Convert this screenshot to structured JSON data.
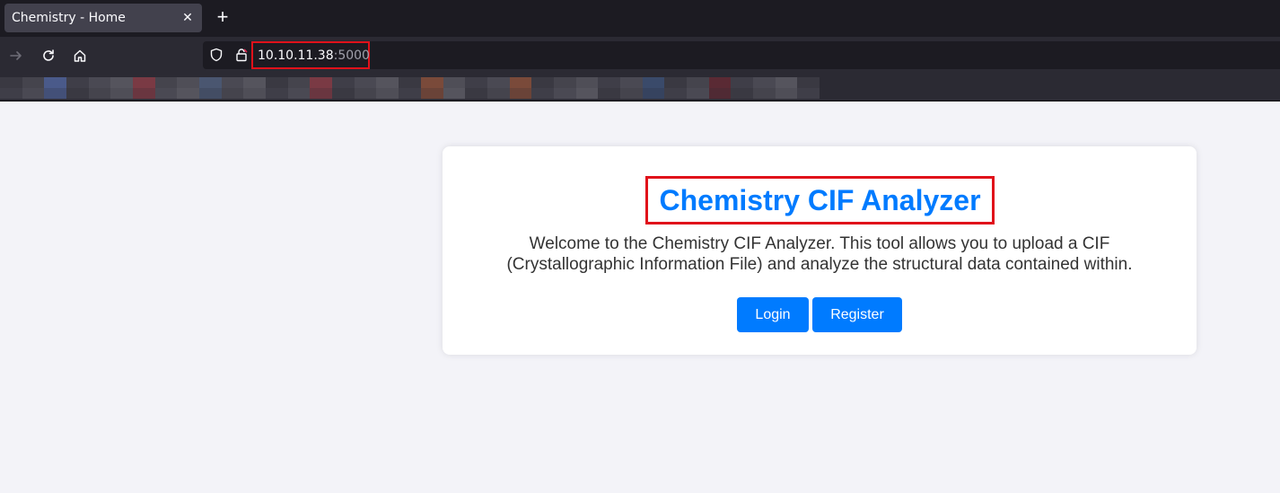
{
  "browser": {
    "tab": {
      "title": "Chemistry - Home",
      "close_icon": "close-icon"
    },
    "new_tab_icon": "plus-icon",
    "nav": {
      "forward_icon": "arrow-right-icon",
      "reload_icon": "reload-icon",
      "home_icon": "home-icon"
    },
    "url": {
      "host": "10.10.11.38",
      "port": ":5000",
      "shield_icon": "shield-icon",
      "lock_icon": "insecure-lock-icon"
    },
    "bookmarks_redacted": true
  },
  "page": {
    "heading": "Chemistry CIF Analyzer",
    "intro": "Welcome to the Chemistry CIF Analyzer. This tool allows you to upload a CIF (Crystallographic Information File) and analyze the structural data contained within.",
    "buttons": {
      "login": "Login",
      "register": "Register"
    }
  },
  "colors": {
    "accent": "#007bff",
    "highlight": "#e0111a",
    "page_bg": "#f3f3f8"
  }
}
